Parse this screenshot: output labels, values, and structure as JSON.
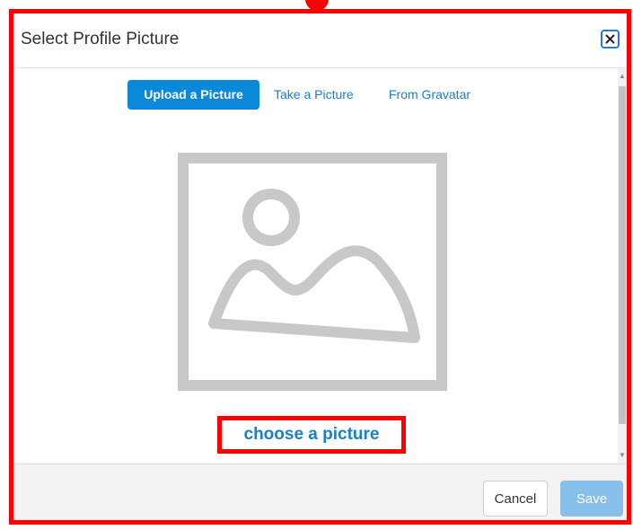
{
  "dialog": {
    "title": "Select Profile Picture",
    "close_icon": "close-x-icon"
  },
  "tabs": [
    {
      "label": "Upload a Picture",
      "active": true
    },
    {
      "label": "Take a Picture",
      "active": false
    },
    {
      "label": "From Gravatar",
      "active": false
    }
  ],
  "placeholder": {
    "icon": "image-placeholder-icon"
  },
  "choose_link": "choose a picture",
  "footer": {
    "cancel_label": "Cancel",
    "save_label": "Save"
  },
  "colors": {
    "accent": "#0b88d8",
    "link": "#1a7fc9",
    "save_disabled": "#86c0eb",
    "highlight": "#ff0000",
    "placeholder_gray": "#c8c8c8"
  }
}
